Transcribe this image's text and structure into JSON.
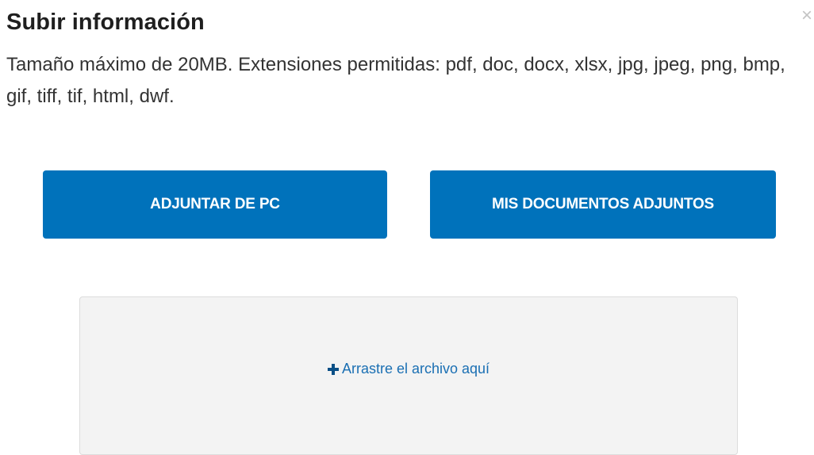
{
  "modal": {
    "title": "Subir información",
    "close_symbol": "×",
    "description": "Tamaño máximo de 20MB. Extensiones permitidas: pdf, doc, docx, xlsx, jpg, jpeg, png, bmp, gif, tiff, tif, html, dwf."
  },
  "buttons": {
    "attach_pc": "ADJUNTAR DE PC",
    "my_documents": "MIS DOCUMENTOS ADJUNTOS"
  },
  "dropzone": {
    "label": "Arrastre el archivo aquí",
    "icon": "plus-icon"
  },
  "colors": {
    "button_bg": "#0072bb",
    "dropzone_bg": "#f3f3f3",
    "link_blue": "#1a6fb3"
  }
}
